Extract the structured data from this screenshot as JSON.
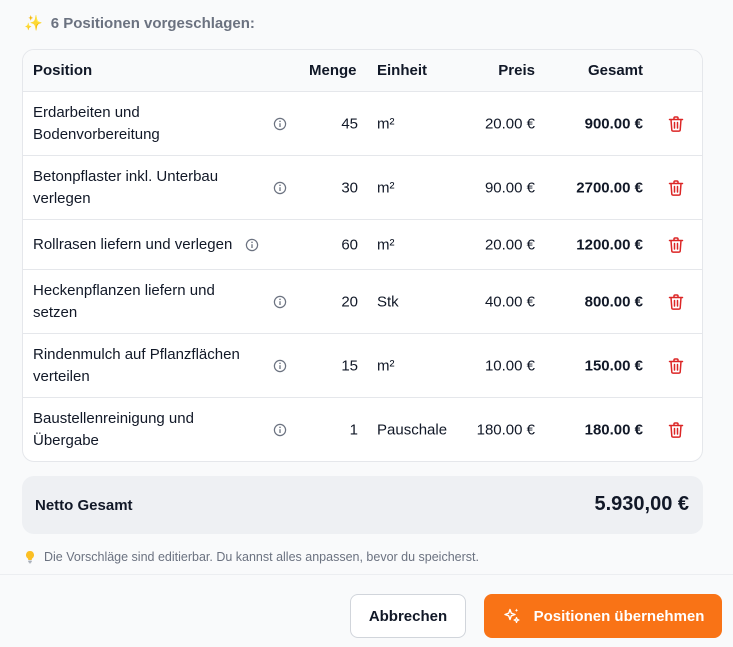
{
  "header": {
    "icon": "sparkles-icon",
    "title": "6 Positionen vorgeschlagen:"
  },
  "table": {
    "columns": {
      "position": "Position",
      "menge": "Menge",
      "einheit": "Einheit",
      "preis": "Preis",
      "gesamt": "Gesamt"
    },
    "rows": [
      {
        "position": "Erdarbeiten und Bodenvorbereitung",
        "menge": "45",
        "einheit": "m²",
        "preis": "20.00 €",
        "gesamt": "900.00 €"
      },
      {
        "position": "Betonpflaster inkl. Unterbau verlegen",
        "menge": "30",
        "einheit": "m²",
        "preis": "90.00 €",
        "gesamt": "2700.00 €"
      },
      {
        "position": "Rollrasen liefern und verlegen",
        "menge": "60",
        "einheit": "m²",
        "preis": "20.00 €",
        "gesamt": "1200.00 €"
      },
      {
        "position": "Heckenpflanzen liefern und setzen",
        "menge": "20",
        "einheit": "Stk",
        "preis": "40.00 €",
        "gesamt": "800.00 €"
      },
      {
        "position": "Rindenmulch auf Pflanzflächen verteilen",
        "menge": "15",
        "einheit": "m²",
        "preis": "10.00 €",
        "gesamt": "150.00 €"
      },
      {
        "position": "Baustellenreinigung und Übergabe",
        "menge": "1",
        "einheit": "Pauschale",
        "preis": "180.00 €",
        "gesamt": "180.00 €"
      }
    ]
  },
  "total": {
    "label": "Netto Gesamt",
    "value": "5.930,00 €"
  },
  "hint": {
    "icon": "lightbulb-icon",
    "text": "Die Vorschläge sind editierbar. Du kannst alles anpassen, bevor du speicherst."
  },
  "buttons": {
    "cancel": "Abbrechen",
    "accept": "Positionen übernehmen"
  },
  "colors": {
    "accent": "#f97316",
    "delete": "#dc2626",
    "muted": "#6b7280"
  }
}
